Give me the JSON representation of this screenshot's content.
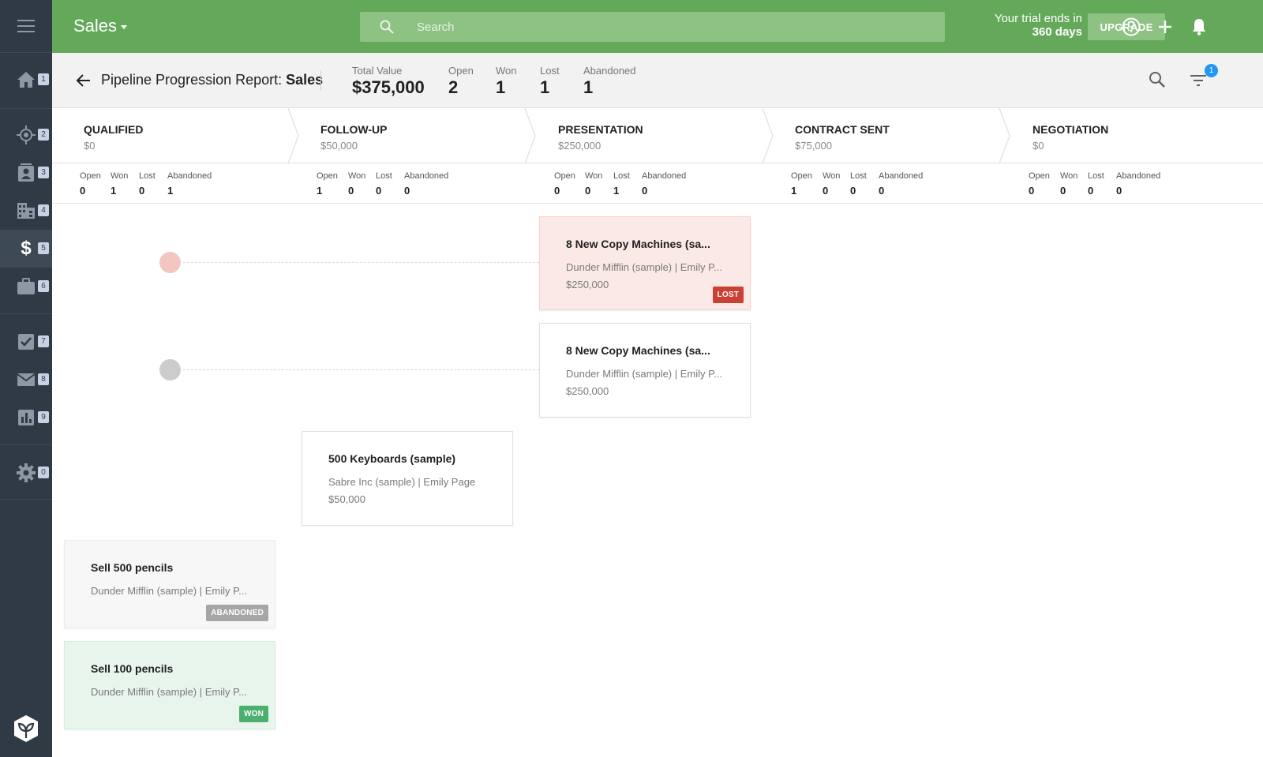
{
  "sidebar": {
    "items": [
      {
        "icon": "home-icon",
        "number": "1"
      },
      {
        "icon": "target-icon",
        "number": "2"
      },
      {
        "icon": "contacts-icon",
        "number": "3"
      },
      {
        "icon": "building-icon",
        "number": "4"
      },
      {
        "icon": "dollar-icon",
        "number": "5",
        "active": true
      },
      {
        "icon": "briefcase-icon",
        "number": "6"
      },
      {
        "icon": "checkbox-icon",
        "number": "7"
      },
      {
        "icon": "mail-icon",
        "number": "8"
      },
      {
        "icon": "bar-chart-icon",
        "number": "9"
      },
      {
        "icon": "gear-icon",
        "number": "0"
      }
    ]
  },
  "topbar": {
    "title": "Sales",
    "search_placeholder": "Search",
    "trial_line1": "Your trial ends in",
    "trial_line2": "360 days",
    "upgrade_label": "UPGRADE"
  },
  "report": {
    "title_prefix": "Pipeline Progression Report: ",
    "title_name": "Sales",
    "filter_count": "1",
    "stats": [
      {
        "label": "Total Value",
        "value": "$375,000"
      },
      {
        "label": "Open",
        "value": "2"
      },
      {
        "label": "Won",
        "value": "1"
      },
      {
        "label": "Lost",
        "value": "1"
      },
      {
        "label": "Abandoned",
        "value": "1"
      }
    ]
  },
  "stages": [
    {
      "name": "QUALIFIED",
      "value": "$0",
      "open": "0",
      "won": "1",
      "lost": "0",
      "abandoned": "1"
    },
    {
      "name": "FOLLOW-UP",
      "value": "$50,000",
      "open": "1",
      "won": "0",
      "lost": "0",
      "abandoned": "0"
    },
    {
      "name": "PRESENTATION",
      "value": "$250,000",
      "open": "0",
      "won": "0",
      "lost": "1",
      "abandoned": "0"
    },
    {
      "name": "CONTRACT SENT",
      "value": "$75,000",
      "open": "1",
      "won": "0",
      "lost": "0",
      "abandoned": "0"
    },
    {
      "name": "NEGOTIATION",
      "value": "$0",
      "open": "0",
      "won": "0",
      "lost": "0",
      "abandoned": "0"
    }
  ],
  "substat_labels": {
    "open": "Open",
    "won": "Won",
    "lost": "Lost",
    "abandoned": "Abandoned"
  },
  "cards": [
    {
      "title": "8 New Copy Machines (sa...",
      "subtitle": "Dunder Mifflin (sample) | Emily P...",
      "value": "$250,000",
      "status": "LOST"
    },
    {
      "title": "8 New Copy Machines (sa...",
      "subtitle": "Dunder Mifflin (sample) | Emily P...",
      "value": "$250,000",
      "status": ""
    },
    {
      "title": "500 Keyboards (sample)",
      "subtitle": "Sabre Inc (sample) | Emily Page",
      "value": "$50,000",
      "status": ""
    },
    {
      "title": "Sell 500 pencils",
      "subtitle": "Dunder Mifflin (sample) | Emily P...",
      "value": "",
      "status": "ABANDONED"
    },
    {
      "title": "Sell 100 pencils",
      "subtitle": "Dunder Mifflin (sample) | Emily P...",
      "value": "",
      "status": "WON"
    }
  ],
  "colors": {
    "brand_green": "#64a95a",
    "sidebar_bg": "#2f3a44",
    "lost_red": "#c94133",
    "won_green": "#4caf70",
    "abandoned_gray": "#a6a6a6",
    "filter_badge_blue": "#2196f3"
  }
}
